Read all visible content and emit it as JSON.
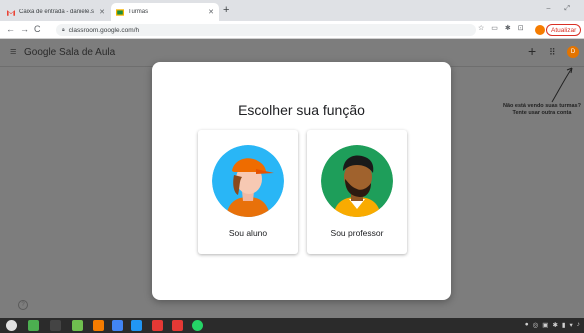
{
  "browser": {
    "tabs": [
      {
        "title": "Caixa de entrada - daniele.s",
        "active": false
      },
      {
        "title": "Turmas",
        "active": true
      }
    ],
    "address": "classroom.google.com/h",
    "update_label": "Atualizar",
    "profile_initial": "D"
  },
  "app": {
    "brand_google": "Google",
    "brand_rest": " Sala de Aula",
    "avatar_initial": "D",
    "hint_text": "Não está vendo suas turmas? Tente usar outra conta"
  },
  "dialog": {
    "title": "Escolher sua função",
    "roles": [
      {
        "label": "Sou aluno"
      },
      {
        "label": "Sou professor"
      }
    ]
  },
  "colors": {
    "student_bg": "#29b6f6",
    "teacher_bg": "#1e9e5a",
    "accent_orange": "#e37400",
    "update_red": "#d93025"
  },
  "icons": {
    "help": "question-mark-icon",
    "menu": "hamburger-menu-icon",
    "apps": "apps-grid-icon",
    "add": "plus-icon"
  }
}
